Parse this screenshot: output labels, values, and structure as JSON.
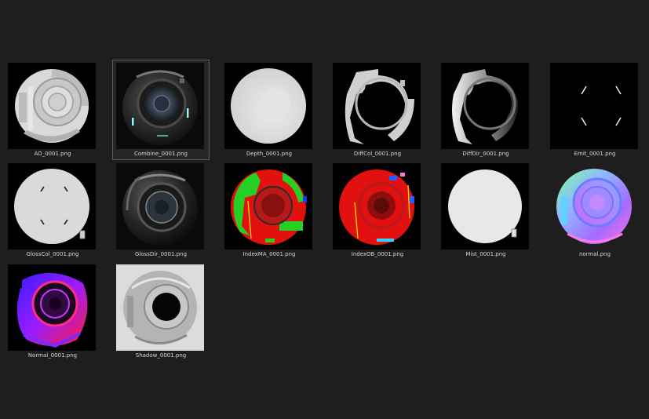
{
  "files": [
    {
      "id": "ao",
      "name": "AO_0001.png",
      "icon": "ao-render-thumbnail"
    },
    {
      "id": "combine",
      "name": "Combine_0001.png",
      "icon": "combine-render-thumbnail",
      "selected": true
    },
    {
      "id": "depth",
      "name": "Depth_0001.png",
      "icon": "depth-render-thumbnail"
    },
    {
      "id": "diffcol",
      "name": "DiffCol_0001.png",
      "icon": "diffcol-render-thumbnail"
    },
    {
      "id": "diffdir",
      "name": "DiffDir_0001.png",
      "icon": "diffdir-render-thumbnail"
    },
    {
      "id": "emit",
      "name": "Emit_0001.png",
      "icon": "emit-render-thumbnail"
    },
    {
      "id": "glosscol",
      "name": "GlossCol_0001.png",
      "icon": "glosscol-render-thumbnail"
    },
    {
      "id": "glossdir",
      "name": "GlossDir_0001.png",
      "icon": "glossdir-render-thumbnail"
    },
    {
      "id": "indexma",
      "name": "IndexMA_0001.png",
      "icon": "indexma-render-thumbnail"
    },
    {
      "id": "indexob",
      "name": "IndexOB_0001.png",
      "icon": "indexob-render-thumbnail"
    },
    {
      "id": "mist",
      "name": "Mist_0001.png",
      "icon": "mist-render-thumbnail"
    },
    {
      "id": "normalpass",
      "name": "normal.png",
      "icon": "normal-map-thumbnail"
    },
    {
      "id": "normal",
      "name": "Normal_0001.png",
      "icon": "normal-render-thumbnail"
    },
    {
      "id": "shadow",
      "name": "Shadow_0001.png",
      "icon": "shadow-render-thumbnail"
    }
  ]
}
